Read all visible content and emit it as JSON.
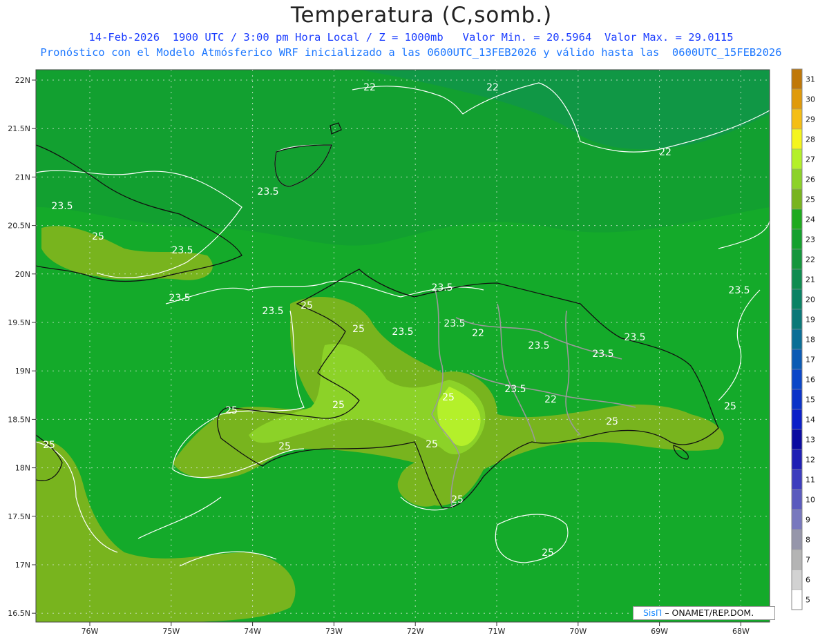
{
  "header": {
    "title": "Temperatura (C,somb.)",
    "line1": "14-Feb-2026  1900 UTC / 3:00 pm Hora Local / Z = 1000mb   Valor Min. = 20.5964  Valor Max. = 29.0115",
    "line2": "Pronóstico con el Modelo Atmósferico WRF inicializado a las 0600UTC_13FEB2026 y válido hasta las  0600UTC_15FEB2026"
  },
  "axes": {
    "lat_labels": [
      "22N",
      "21.5N",
      "21N",
      "20.5N",
      "20N",
      "19.5N",
      "19N",
      "18.5N",
      "18N",
      "17.5N",
      "17N",
      "16.5N"
    ],
    "lon_labels": [
      "76W",
      "75W",
      "74W",
      "73W",
      "72W",
      "71W",
      "70W",
      "69W",
      "68W"
    ]
  },
  "contour_labels": [
    "22",
    "22",
    "22",
    "22",
    "22",
    "23.5",
    "23.5",
    "23.5",
    "23.5",
    "23.5",
    "23.5",
    "23.5",
    "23.5",
    "23.5",
    "23.5",
    "23.5",
    "23.5",
    "23.5",
    "25",
    "25",
    "25",
    "25",
    "25",
    "25",
    "25",
    "25",
    "25",
    "25",
    "25",
    "25",
    "25"
  ],
  "colorbar": {
    "levels": [
      "31",
      "30",
      "29",
      "28",
      "27",
      "26",
      "25",
      "24",
      "23",
      "22",
      "21",
      "20",
      "19",
      "18",
      "17",
      "16",
      "15",
      "14",
      "13",
      "12",
      "11",
      "10",
      "9",
      "8",
      "7",
      "6",
      "5"
    ],
    "colors": [
      "#c07808",
      "#e09a0a",
      "#f5be14",
      "#f5f51e",
      "#b4f02a",
      "#8cd228",
      "#78b41e",
      "#1eaa1e",
      "#14a02d",
      "#14963c",
      "#0f8c50",
      "#0a8264",
      "#0a7878",
      "#0a6e96",
      "#0a5ab4",
      "#0a46c8",
      "#0a32c8",
      "#0a1ec8",
      "#0a0aa0",
      "#1e1eb4",
      "#3c3cbe",
      "#5a5abe",
      "#7878be",
      "#9696aa",
      "#b4b4b4",
      "#d2d2d2",
      "#ffffff"
    ]
  },
  "credit": {
    "brand": "SisΠ",
    "text": "– ONAMET/REP.DOM."
  }
}
